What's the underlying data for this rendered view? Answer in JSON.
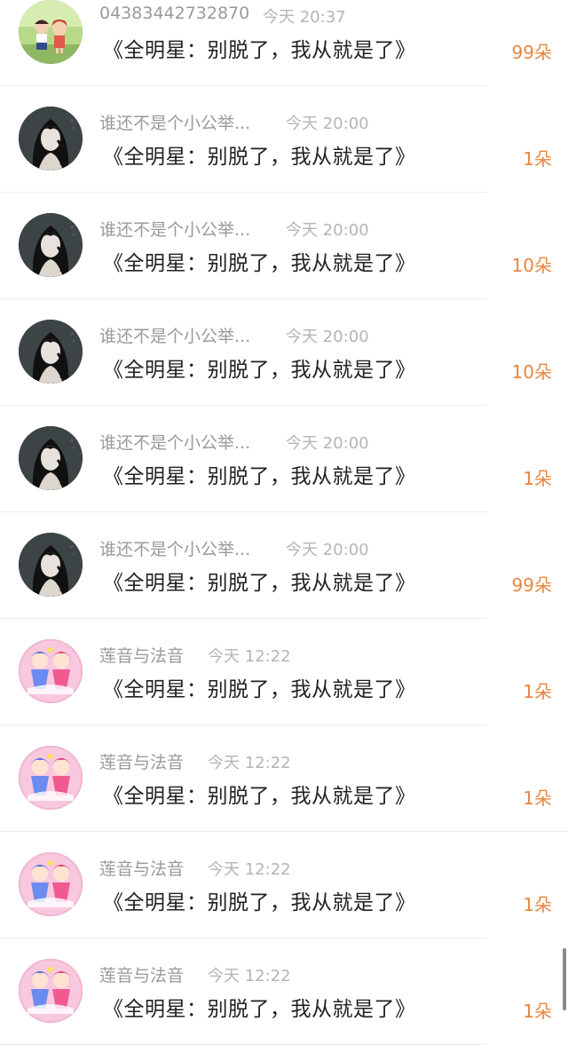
{
  "title_text": "《全明星：别脱了，我从就是了》",
  "colors": {
    "count": "#e8863e",
    "name": "#9a9a9a",
    "time": "#b5b5b5",
    "title": "#222222"
  },
  "items": [
    {
      "name": "04383442732870",
      "time": "今天 20:37",
      "count": "99朵",
      "avatar": "anime-kids-avatar"
    },
    {
      "name": "谁还不是个小公举...",
      "time": "今天 20:00",
      "count": "1朵",
      "avatar": "dark-haired-girl-avatar"
    },
    {
      "name": "谁还不是个小公举...",
      "time": "今天 20:00",
      "count": "10朵",
      "avatar": "dark-haired-girl-avatar"
    },
    {
      "name": "谁还不是个小公举...",
      "time": "今天 20:00",
      "count": "10朵",
      "avatar": "dark-haired-girl-avatar"
    },
    {
      "name": "谁还不是个小公举...",
      "time": "今天 20:00",
      "count": "1朵",
      "avatar": "dark-haired-girl-avatar"
    },
    {
      "name": "谁还不是个小公举...",
      "time": "今天 20:00",
      "count": "99朵",
      "avatar": "dark-haired-girl-avatar"
    },
    {
      "name": "莲音与法音",
      "time": "今天 12:22",
      "count": "1朵",
      "avatar": "magical-girls-avatar"
    },
    {
      "name": "莲音与法音",
      "time": "今天 12:22",
      "count": "1朵",
      "avatar": "magical-girls-avatar"
    },
    {
      "name": "莲音与法音",
      "time": "今天 12:22",
      "count": "1朵",
      "avatar": "magical-girls-avatar"
    },
    {
      "name": "莲音与法音",
      "time": "今天 12:22",
      "count": "1朵",
      "avatar": "magical-girls-avatar"
    }
  ]
}
